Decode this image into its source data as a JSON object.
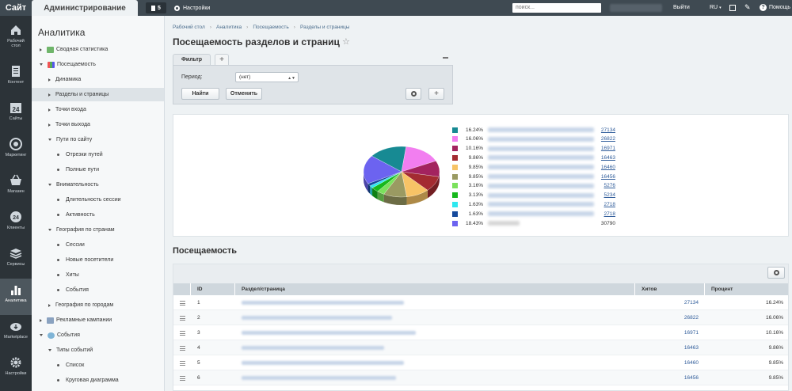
{
  "topbar": {
    "site_tab": "Сайт",
    "admin_tab": "Администрирование",
    "notifications_count": "5",
    "settings_label": "Настройки",
    "search_placeholder": "поиск...",
    "logout_label": "Выйти",
    "lang_label": "RU",
    "help_label": "Помощь"
  },
  "leftbar": [
    {
      "label": "Рабочий стол",
      "icon": "home-icon"
    },
    {
      "label": "Контент",
      "icon": "document-icon"
    },
    {
      "label": "Сайты",
      "icon": "calendar-24-icon"
    },
    {
      "label": "Маркетинг",
      "icon": "target-icon"
    },
    {
      "label": "Магазин",
      "icon": "basket-icon"
    },
    {
      "label": "Клиенты",
      "icon": "clients-24-icon"
    },
    {
      "label": "Сервисы",
      "icon": "layers-icon"
    },
    {
      "label": "Аналитика",
      "icon": "bar-chart-icon"
    },
    {
      "label": "Marketplace",
      "icon": "cloud-download-icon"
    },
    {
      "label": "Настройки",
      "icon": "gear-icon"
    }
  ],
  "sidebar": {
    "title": "Аналитика",
    "items": [
      {
        "label": "Сводная статистика"
      },
      {
        "label": "Посещаемость"
      },
      {
        "label": "Динамика"
      },
      {
        "label": "Разделы и страницы"
      },
      {
        "label": "Точки входа"
      },
      {
        "label": "Точки выхода"
      },
      {
        "label": "Пути по сайту"
      },
      {
        "label": "Отрезки путей"
      },
      {
        "label": "Полные пути"
      },
      {
        "label": "Внимательность"
      },
      {
        "label": "Длительность сессии"
      },
      {
        "label": "Активность"
      },
      {
        "label": "География по странам"
      },
      {
        "label": "Сессии"
      },
      {
        "label": "Новые посетители"
      },
      {
        "label": "Хиты"
      },
      {
        "label": "События"
      },
      {
        "label": "География по городам"
      },
      {
        "label": "Рекламные кампании"
      },
      {
        "label": "События"
      },
      {
        "label": "Типы событий"
      },
      {
        "label": "Список"
      },
      {
        "label": "Круговая диаграмма"
      }
    ]
  },
  "breadcrumb": [
    "Рабочий стол",
    "Аналитика",
    "Посещаемость",
    "Разделы и страницы"
  ],
  "page_title": "Посещаемость разделов и страниц",
  "filter": {
    "tab_label": "Фильтр",
    "period_label": "Период:",
    "period_value": "(нет)",
    "find_label": "Найти",
    "cancel_label": "Отменить"
  },
  "chart_data": {
    "type": "pie",
    "slices": [
      {
        "pct": "16.24%",
        "value": "27134",
        "color": "#178a93"
      },
      {
        "pct": "16.06%",
        "value": "26822",
        "color": "#f27ef0"
      },
      {
        "pct": "10.16%",
        "value": "16971",
        "color": "#a3235f"
      },
      {
        "pct": "9.86%",
        "value": "16463",
        "color": "#a32b31"
      },
      {
        "pct": "9.85%",
        "value": "16460",
        "color": "#f7c366"
      },
      {
        "pct": "9.85%",
        "value": "16456",
        "color": "#9a9a62"
      },
      {
        "pct": "3.16%",
        "value": "5276",
        "color": "#7be15c"
      },
      {
        "pct": "3.13%",
        "value": "5234",
        "color": "#17b81c"
      },
      {
        "pct": "1.63%",
        "value": "2718",
        "color": "#2ee8f0"
      },
      {
        "pct": "1.63%",
        "value": "2718",
        "color": "#164a9c"
      },
      {
        "pct": "18.43%",
        "value": "30790",
        "color": "#6c63f0"
      }
    ]
  },
  "table": {
    "section_title": "Посещаемость",
    "headers": [
      "ID",
      "Раздел/страница",
      "Хитов",
      "Процент"
    ],
    "rows": [
      {
        "id": "1",
        "hits": "27134",
        "pct": "16.24%"
      },
      {
        "id": "2",
        "hits": "26822",
        "pct": "16.06%"
      },
      {
        "id": "3",
        "hits": "16971",
        "pct": "10.16%"
      },
      {
        "id": "4",
        "hits": "16463",
        "pct": "9.86%"
      },
      {
        "id": "5",
        "hits": "16460",
        "pct": "9.85%"
      },
      {
        "id": "6",
        "hits": "16456",
        "pct": "9.85%"
      }
    ]
  }
}
